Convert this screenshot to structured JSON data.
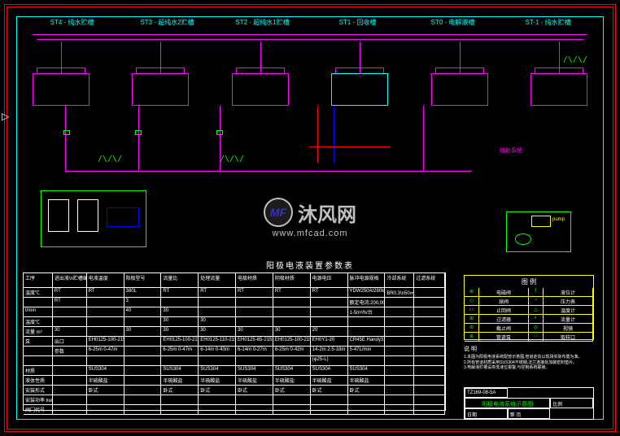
{
  "header": {
    "stations": [
      "ST4 - 纯水贮槽",
      "ST3 - 超纯水2贮槽",
      "ST2 - 超纯水1贮槽",
      "ST1 - 回收槽",
      "ST0 - 电解液槽",
      "ST-1 - 纯水贮槽"
    ]
  },
  "diagram_title": "阳极电液装置参数表",
  "table": {
    "headers": [
      "工序",
      "进出液\\n贮槽编号",
      "电液温度",
      "阳极型号",
      "流量比",
      "处理流量",
      "电极材质",
      "阴极材质",
      "电源电压",
      "脉冲电源规格",
      "冷却系统",
      "过滤系统"
    ],
    "rows": [
      [
        "温度℃",
        "RT",
        "RT",
        "380L",
        "RT",
        "RT",
        "RT",
        "RT",
        "RT",
        "YDW250A/280kW",
        "BR0.3\\n50㎡",
        ""
      ],
      [
        "",
        "RT",
        "",
        "3",
        "",
        "",
        "",
        "",
        "",
        "额定电流:200,000mA/h",
        "",
        ""
      ],
      [
        "t/min",
        "",
        "",
        "40",
        "30",
        "",
        "",
        "",
        "",
        "1-5m³/h/台",
        "",
        ""
      ],
      [
        "温度℃",
        "",
        "",
        "",
        "30",
        "30",
        "",
        "",
        "",
        "",
        "",
        ""
      ],
      [
        "流量 m³",
        "30",
        "",
        "30",
        "30",
        "30",
        "30",
        "30",
        "20",
        "",
        "",
        ""
      ],
      [
        "泵",
        "出口",
        "EH0125-100-215",
        "",
        "EH0125-100-215",
        "EH0125-110-215",
        "EH0125-65-215",
        "EH0125-100-215",
        "EH0Y1-20",
        "CR45E Handy310",
        "",
        ""
      ],
      [
        "",
        "参数",
        "6-25m 0-47m",
        "",
        "6-25m 0-47m",
        "6-14m 0-43m",
        "6-14m 0-27m",
        "6-25m 0-42m",
        "14-2m 2.5-18m",
        "5-47L/min",
        "",
        ""
      ],
      [
        "",
        "",
        "",
        "",
        "",
        "",
        "",
        "",
        "(φ25-L)",
        "",
        "",
        ""
      ],
      [
        "材质",
        "",
        "SUS304",
        "",
        "SUS304",
        "SUS304",
        "SUS304",
        "SUS304",
        "SUS304",
        "SUS304",
        "",
        ""
      ],
      [
        "液体性质",
        "",
        "半硫酸盐",
        "",
        "半硫酸盐",
        "半硫酸盐",
        "半硫酸盐",
        "半硫酸盐",
        "半硫酸盐",
        "半硫酸盐",
        "",
        ""
      ],
      [
        "安装形式",
        "",
        "卧式",
        "",
        "卧式",
        "卧式",
        "卧式",
        "卧式",
        "卧式",
        "卧式",
        "",
        ""
      ],
      [
        "安装功率 kw",
        "",
        "",
        "",
        "",
        "",
        "",
        "",
        "",
        "",
        "",
        ""
      ],
      [
        "阀门代号",
        "",
        "",
        "",
        "",
        "",
        "",
        "",
        "",
        "",
        "",
        ""
      ]
    ]
  },
  "legend": {
    "title": "图 例",
    "items": [
      {
        "sym": "⊗",
        "label": "电磁阀"
      },
      {
        "sym": "†",
        "label": "液位计"
      },
      {
        "sym": "◇",
        "label": "球阀"
      },
      {
        "sym": "○",
        "label": "压力表"
      },
      {
        "sym": "▭",
        "label": "止回阀"
      },
      {
        "sym": "△",
        "label": "温度计"
      },
      {
        "sym": "⊞",
        "label": "过滤器"
      },
      {
        "sym": "◐",
        "label": "流量计"
      },
      {
        "sym": "⊘",
        "label": "截止阀"
      },
      {
        "sym": "◎",
        "label": "视镜"
      },
      {
        "sym": "⊕",
        "label": "管道泵"
      },
      {
        "sym": "□",
        "label": "取样口"
      }
    ]
  },
  "notes": {
    "title": "说 明",
    "lines": [
      "1.本图为阳极电液系统配管示意图,管道走向以现场实际布置为准。",
      "2.所有管道材质采用SUS304不锈钢,法兰连接处加装密封垫片。",
      "3.电解液贮槽设高低液位报警,与控制系统联锁。"
    ]
  },
  "title_block": {
    "drawing_no": "TZ169-08-5A",
    "drawing_name": "阳极电液系统示意图",
    "scale": "比例",
    "date": "日期",
    "sheet": "第 页"
  },
  "watermark": {
    "brand": "沐风网",
    "url": "www.mfcad.com",
    "logo": "MF"
  },
  "annotations": {
    "aux_label": "辅助系统",
    "pump_label": "pump"
  }
}
